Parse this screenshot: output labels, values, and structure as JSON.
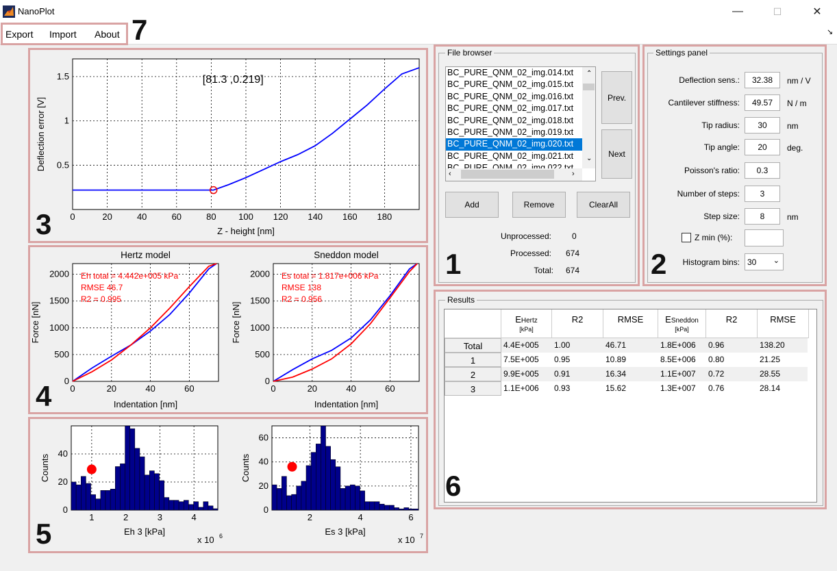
{
  "window": {
    "title": "NanoPlot",
    "minimize": "—",
    "maximize": "☐",
    "close": "✕"
  },
  "menu": {
    "items": [
      "Export",
      "Import",
      "About"
    ],
    "corner_glyph": "↘"
  },
  "callouts": [
    "1",
    "2",
    "3",
    "4",
    "5",
    "6",
    "7"
  ],
  "file_browser": {
    "title": "File browser",
    "files": [
      "BC_PURE_QNM_02_img.014.txt",
      "BC_PURE_QNM_02_img.015.txt",
      "BC_PURE_QNM_02_img.016.txt",
      "BC_PURE_QNM_02_img.017.txt",
      "BC_PURE_QNM_02_img.018.txt",
      "BC_PURE_QNM_02_img.019.txt",
      "BC_PURE_QNM_02_img.020.txt",
      "BC_PURE_QNM_02_img.021.txt",
      "BC_PURE_QNM_02_img.022.txt"
    ],
    "selected_index": 6,
    "prev_label": "Prev.",
    "next_label": "Next",
    "add_label": "Add",
    "remove_label": "Remove",
    "clearall_label": "ClearAll",
    "stats": [
      {
        "label": "Unprocessed:",
        "value": "0"
      },
      {
        "label": "Processed:",
        "value": "674"
      },
      {
        "label": "Total:",
        "value": "674"
      }
    ]
  },
  "settings": {
    "title": "Settings panel",
    "rows": [
      {
        "label": "Deflection sens.:",
        "value": "32.38",
        "unit": "nm / V"
      },
      {
        "label": "Cantilever stiffness:",
        "value": "49.57",
        "unit": "N / m"
      },
      {
        "label": "Tip radius:",
        "value": "30",
        "unit": "nm"
      },
      {
        "label": "Tip angle:",
        "value": "20",
        "unit": "deg."
      },
      {
        "label": "Poisson's ratio:",
        "value": "0.3",
        "unit": ""
      },
      {
        "label": "Number of steps:",
        "value": "3",
        "unit": ""
      },
      {
        "label": "Step size:",
        "value": "8",
        "unit": "nm"
      }
    ],
    "zmin_label": "Z min (%):",
    "zmin_value": "",
    "zmin_checked": false,
    "histogram_label": "Histogram bins:",
    "histogram_value": "30"
  },
  "results": {
    "title": "Results",
    "headers": [
      {
        "main": "E",
        "sub_inline": "Hertz",
        "sub": "[kPa]"
      },
      {
        "main": "R2",
        "sub_inline": "",
        "sub": ""
      },
      {
        "main": "RMSE",
        "sub_inline": "",
        "sub": ""
      },
      {
        "main": "E",
        "sub_inline": "Sneddon",
        "sub": "[kPa]"
      },
      {
        "main": "R2",
        "sub_inline": "",
        "sub": ""
      },
      {
        "main": "RMSE",
        "sub_inline": "",
        "sub": ""
      }
    ],
    "rows": [
      {
        "name": "Total",
        "cells": [
          "4.4E+005",
          "1.00",
          "46.71",
          "1.8E+006",
          "0.96",
          "138.20"
        ]
      },
      {
        "name": "1",
        "cells": [
          "7.5E+005",
          "0.95",
          "10.89",
          "8.5E+006",
          "0.80",
          "21.25"
        ]
      },
      {
        "name": "2",
        "cells": [
          "9.9E+005",
          "0.91",
          "16.34",
          "1.1E+007",
          "0.72",
          "28.55"
        ]
      },
      {
        "name": "3",
        "cells": [
          "1.1E+006",
          "0.93",
          "15.62",
          "1.3E+007",
          "0.76",
          "28.14"
        ]
      }
    ]
  },
  "chart_data": [
    {
      "type": "line",
      "xlabel": "Z - height [nm]",
      "ylabel": "Deflection error [V]",
      "xlim": [
        0,
        200
      ],
      "ylim": [
        0,
        1.7
      ],
      "xticks": [
        0,
        20,
        40,
        60,
        80,
        100,
        120,
        140,
        160,
        180
      ],
      "yticks": [
        0.5,
        1,
        1.5
      ],
      "grid": true,
      "annotation": "[81.3 ,0.219]",
      "marker": {
        "x": 81.3,
        "y": 0.219
      },
      "series": [
        {
          "color": "#0000ff",
          "x": [
            0,
            81.3,
            90,
            100,
            110,
            120,
            130,
            140,
            150,
            160,
            170,
            180,
            190,
            200
          ],
          "y": [
            0.219,
            0.219,
            0.28,
            0.36,
            0.45,
            0.54,
            0.62,
            0.72,
            0.86,
            1.02,
            1.18,
            1.36,
            1.53,
            1.6
          ]
        }
      ]
    },
    {
      "type": "line",
      "title": "Hertz model",
      "xlabel": "Indentation [nm]",
      "ylabel": "Force [nN]",
      "xlim": [
        0,
        75
      ],
      "ylim": [
        0,
        2200
      ],
      "xticks": [
        0,
        20,
        40,
        60
      ],
      "yticks": [
        0,
        500,
        1000,
        1500,
        2000
      ],
      "grid": true,
      "annotations": [
        "Eh total = 4.442e+005 kPa",
        "RMSE 46.7",
        "R2 = 0.995"
      ],
      "series": [
        {
          "color": "#0000ff",
          "x": [
            0,
            10,
            20,
            30,
            40,
            50,
            60,
            70,
            74
          ],
          "y": [
            0,
            250,
            470,
            680,
            940,
            1250,
            1650,
            2100,
            2200
          ]
        },
        {
          "color": "#ff0000",
          "x": [
            0,
            10,
            20,
            30,
            40,
            50,
            60,
            70,
            74
          ],
          "y": [
            0,
            180,
            400,
            680,
            1000,
            1370,
            1770,
            2150,
            2200
          ]
        }
      ]
    },
    {
      "type": "line",
      "title": "Sneddon model",
      "xlabel": "Indentation [nm]",
      "ylabel": "Force [nN]",
      "xlim": [
        0,
        75
      ],
      "ylim": [
        0,
        2200
      ],
      "xticks": [
        0,
        20,
        40,
        60
      ],
      "yticks": [
        0,
        500,
        1000,
        1500,
        2000
      ],
      "grid": true,
      "annotations": [
        "Es total = 1.817e+006 kPa",
        "RMSE 138",
        "R2 = 0.956"
      ],
      "series": [
        {
          "color": "#0000ff",
          "x": [
            0,
            10,
            20,
            30,
            40,
            50,
            60,
            70,
            74
          ],
          "y": [
            0,
            220,
            420,
            580,
            810,
            1150,
            1600,
            2100,
            2200
          ]
        },
        {
          "color": "#ff0000",
          "x": [
            0,
            10,
            20,
            30,
            40,
            50,
            60,
            70,
            74
          ],
          "y": [
            0,
            80,
            230,
            420,
            700,
            1080,
            1560,
            2050,
            2200
          ]
        }
      ]
    },
    {
      "type": "bar",
      "xlabel": "Eh 3 [kPa]",
      "ylabel": "Counts",
      "exponent_base": "x 10",
      "exponent": "6",
      "xlim": [
        0.4,
        4.7
      ],
      "ylim": [
        0,
        60
      ],
      "xticks": [
        1,
        2,
        3,
        4
      ],
      "yticks": [
        0,
        20,
        40
      ],
      "grid": true,
      "bin_start": 0.4,
      "bin_width": 0.1435,
      "values": [
        20,
        18,
        24,
        19,
        11,
        8,
        14,
        14,
        15,
        31,
        33,
        60,
        58,
        44,
        38,
        25,
        28,
        26,
        21,
        9,
        7,
        7,
        6,
        7,
        4,
        6,
        2,
        6,
        3,
        1
      ],
      "marker": {
        "x": 1.0,
        "y": 29
      }
    },
    {
      "type": "bar",
      "xlabel": "Es 3 [kPa]",
      "ylabel": "Counts",
      "exponent_base": "x 10",
      "exponent": "7",
      "xlim": [
        0.5,
        6.3
      ],
      "ylim": [
        0,
        70
      ],
      "xticks": [
        2,
        4,
        6
      ],
      "yticks": [
        0,
        20,
        40,
        60
      ],
      "grid": true,
      "bin_start": 0.5,
      "bin_width": 0.1935,
      "values": [
        21,
        18,
        28,
        12,
        13,
        20,
        24,
        37,
        48,
        55,
        70,
        53,
        42,
        36,
        18,
        20,
        21,
        20,
        16,
        7,
        7,
        7,
        5,
        4,
        4,
        2,
        1,
        2,
        1,
        1
      ],
      "marker": {
        "x": 1.3,
        "y": 36
      }
    }
  ]
}
